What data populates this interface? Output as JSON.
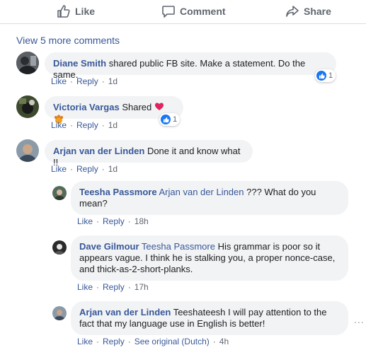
{
  "actions": {
    "like_label": "Like",
    "comment_label": "Comment",
    "share_label": "Share"
  },
  "view_more": "View 5 more comments",
  "comments": [
    {
      "author": "Diane Smith",
      "text": "shared public FB site. Make a statement. Do the same.",
      "like_label": "Like",
      "reply_label": "Reply",
      "time": "1d",
      "reaction_count": "1"
    },
    {
      "author": "Victoria Vargas",
      "text": "Shared",
      "like_label": "Like",
      "reply_label": "Reply",
      "time": "1d",
      "reaction_count": "1"
    },
    {
      "author": "Arjan van der Linden",
      "text": "Done it and know what !!",
      "like_label": "Like",
      "reply_label": "Reply",
      "time": "1d"
    }
  ],
  "replies": [
    {
      "author": "Teesha Passmore",
      "mention": "Arjan van der Linden",
      "text_line1": " ??? What do you",
      "text_line2": "mean?",
      "like_label": "Like",
      "reply_label": "Reply",
      "time": "18h"
    },
    {
      "author": "Dave Gilmour",
      "mention": "Teesha Passmore",
      "text_line1": " His grammar is poor so it",
      "text_line2": "appears vague. I think he is stalking you, a proper nonce-case,",
      "text_line3": "and thick-as-2-short-planks.",
      "like_label": "Like",
      "reply_label": "Reply",
      "time": "17h"
    },
    {
      "author": "Arjan van der Linden",
      "text_line1": " Teeshateesh I will pay attention to the",
      "text_line2": "fact that my language use in English is better!",
      "like_label": "Like",
      "reply_label": "Reply",
      "see_original": "See original (Dutch)",
      "time": "4h",
      "more": "..."
    }
  ],
  "separator": "·",
  "colors": {
    "link": "#385898",
    "bubble": "#f2f3f5",
    "meta": "#606770",
    "like_blue": "#1877f2"
  }
}
